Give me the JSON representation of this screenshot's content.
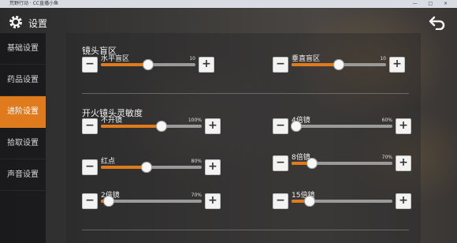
{
  "window": {
    "title": "荒野行动 · CC直播小鱼",
    "controls": "— □ ×"
  },
  "header": {
    "title": "设置"
  },
  "sidebar": {
    "items": [
      {
        "label": "基础设置",
        "active": false
      },
      {
        "label": "药品设置",
        "active": false
      },
      {
        "label": "进阶设置",
        "active": true
      },
      {
        "label": "拾取设置",
        "active": false
      },
      {
        "label": "声音设置",
        "active": false
      }
    ]
  },
  "sections": {
    "blind": {
      "title": "镜头盲区"
    },
    "scope": {
      "title": "开火镜头灵敏度"
    }
  },
  "sliders": [
    {
      "id": "horizontal-blind",
      "label": "水平盲区",
      "max": "10",
      "level": 0.5,
      "minus": "−",
      "plus": "+"
    },
    {
      "id": "vertical-blind",
      "label": "垂直盲区",
      "max": "10",
      "level": 0.5,
      "minus": "−",
      "plus": "+"
    },
    {
      "id": "no-scope",
      "label": "不开镜",
      "max": "100%",
      "level": 0.6,
      "minus": "−",
      "plus": "+"
    },
    {
      "id": "scope-4x",
      "label": "4倍镜",
      "max": "60%",
      "level": 0.05,
      "minus": "−",
      "plus": "+"
    },
    {
      "id": "red-dot",
      "label": "红点",
      "max": "80%",
      "level": 0.45,
      "minus": "−",
      "plus": "+"
    },
    {
      "id": "scope-8x",
      "label": "8倍镜",
      "max": "70%",
      "level": 0.2,
      "minus": "−",
      "plus": "+"
    },
    {
      "id": "scope-2x",
      "label": "2倍镜",
      "max": "70%",
      "level": 0.08,
      "minus": "−",
      "plus": "+"
    },
    {
      "id": "scope-15x",
      "label": "15倍镜",
      "max": "",
      "level": 0.18,
      "minus": "−",
      "plus": "+"
    }
  ],
  "colors": {
    "accent": "#e07b1d",
    "track": "#9a9a9a"
  },
  "icons": {
    "settings": "gear-icon",
    "back": "back-arrow-icon"
  }
}
